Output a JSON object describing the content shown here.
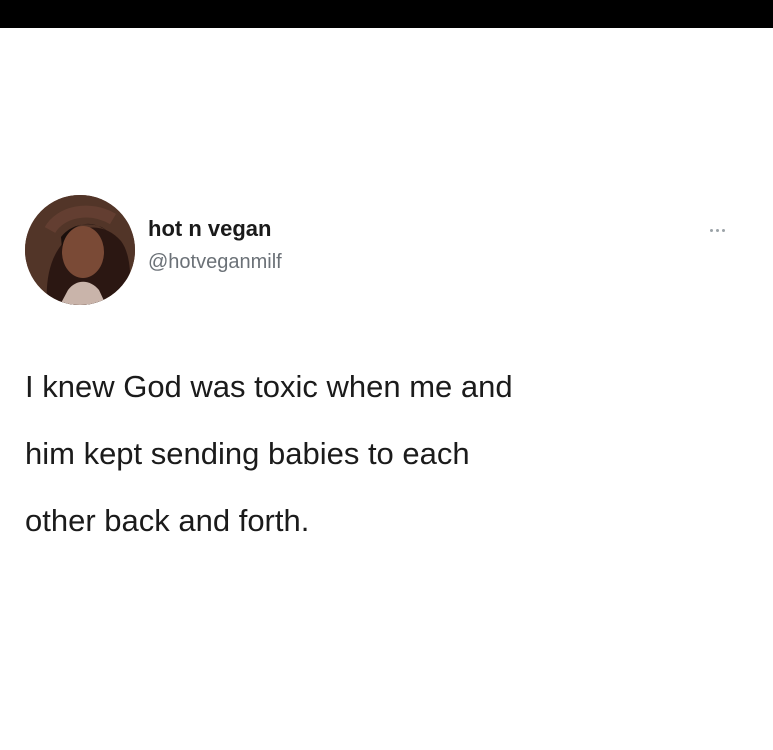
{
  "tweet": {
    "display_name": "hot n vegan",
    "handle": "@hotveganmilf",
    "text_lines": [
      "I knew God was toxic when me and",
      "him kept sending babies to each",
      "other back and forth."
    ],
    "more_icon": "ellipsis-icon",
    "avatar_icon": "profile-photo"
  },
  "colors": {
    "top_bar": "#000000",
    "background": "#ffffff",
    "name": "#1a1a1a",
    "handle": "#6b7177",
    "text": "#1b1b1b",
    "more": "#9ca3a8"
  }
}
